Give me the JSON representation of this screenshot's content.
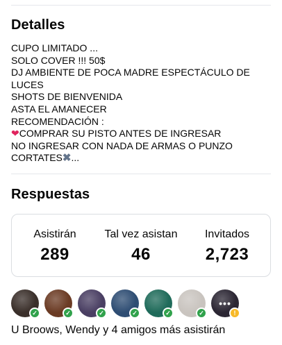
{
  "details": {
    "title": "Detalles",
    "lines": [
      "CUPO LIMITADO ...",
      "SOLO COVER !!! 50$",
      "DJ AMBIENTE DE POCA MADRE  ESPECTÁCULO DE LUCES",
      "SHOTS DE BIENVENIDA",
      "ASTA EL AMANECER",
      "RECOMENDACIÓN :",
      "COMPRAR SU PISTO ANTES DE INGRESAR",
      "NO INGRESAR CON NADA DE ARMAS O PUNZO CORTATES",
      "..."
    ]
  },
  "responses": {
    "title": "Respuestas",
    "stats": [
      {
        "label": "Asistirán",
        "value": "289"
      },
      {
        "label": "Tal vez asistan",
        "value": "46"
      },
      {
        "label": "Invitados",
        "value": "2,723"
      }
    ],
    "avatars": [
      {
        "status": "going",
        "color": "#3a2f2a"
      },
      {
        "status": "going",
        "color": "#6b3b24"
      },
      {
        "status": "going",
        "color": "#4a3f63"
      },
      {
        "status": "going",
        "color": "#2e4d73"
      },
      {
        "status": "going",
        "color": "#1f6b5a"
      },
      {
        "status": "going",
        "color": "#c9c4bf"
      },
      {
        "status": "maybe",
        "color": "#2b2633"
      }
    ],
    "more_indicator": "•••",
    "attendees_text": "U Broows, Wendy y 4 amigos más asistirán"
  },
  "icons": {
    "heart": "heart-icon",
    "cross": "cross-mark-icon",
    "check": "check-icon",
    "clock": "clock-icon"
  },
  "colors": {
    "going_badge": "#31a24c",
    "maybe_badge": "#f7b928",
    "heart": "#e0245e"
  }
}
